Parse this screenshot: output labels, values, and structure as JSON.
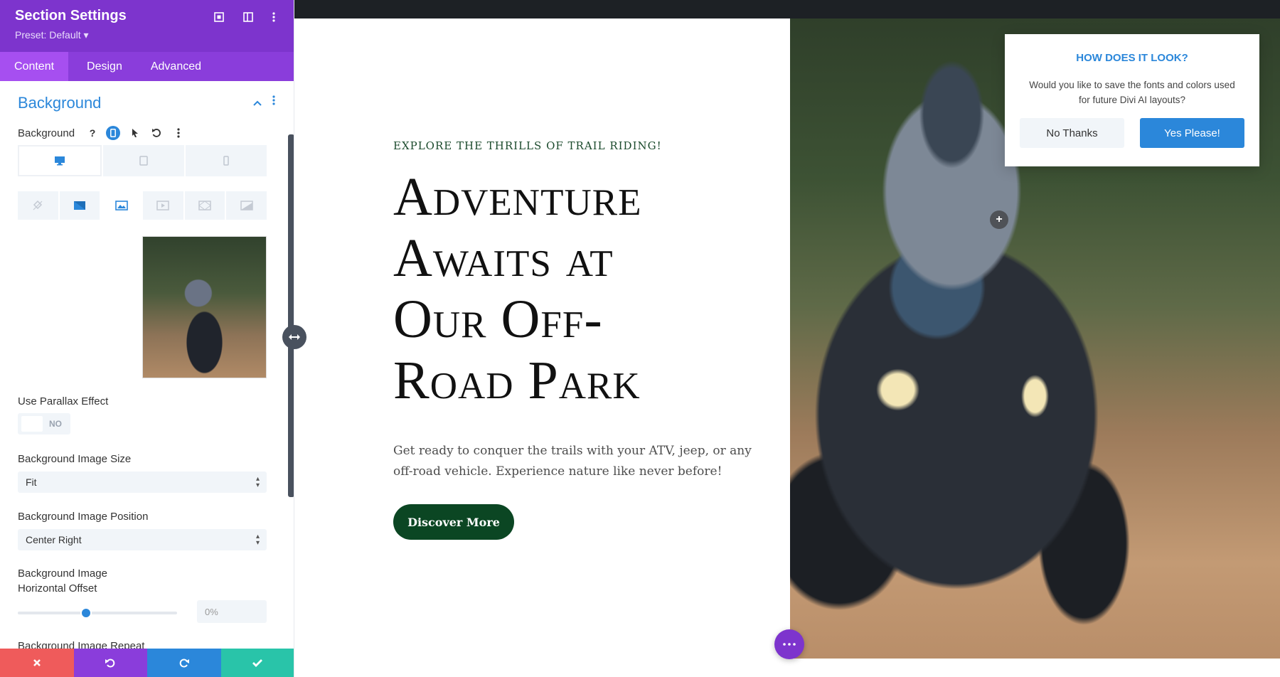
{
  "panel": {
    "title": "Section Settings",
    "preset": "Preset: Default ▾",
    "tabs": [
      {
        "label": "Content",
        "active": true
      },
      {
        "label": "Design",
        "active": false
      },
      {
        "label": "Advanced",
        "active": false
      }
    ],
    "section_title": "Background",
    "background_label": "Background",
    "parallax": {
      "label": "Use Parallax Effect",
      "value": "NO"
    },
    "image_size": {
      "label": "Background Image Size",
      "value": "Fit"
    },
    "image_position": {
      "label": "Background Image Position",
      "value": "Center Right"
    },
    "h_offset": {
      "label_line1": "Background Image",
      "label_line2": "Horizontal Offset",
      "value": "0%",
      "slider_fraction": 0.43
    },
    "repeat_label": "Background Image Repeat"
  },
  "canvas": {
    "eyebrow": "EXPLORE THE THRILLS OF TRAIL RIDING!",
    "headline_lines": [
      "Adventure",
      "Awaits at",
      "Our Off-",
      "Road Park"
    ],
    "paragraph": "Get ready to conquer the trails with your ATV, jeep, or any off-road vehicle. Experience nature like never before!",
    "button": "Discover More"
  },
  "popup": {
    "title": "HOW DOES IT LOOK?",
    "body": "Would you like to save the fonts and colors used for future Divi AI layouts?",
    "no_label": "No Thanks",
    "yes_label": "Yes Please!"
  },
  "colors": {
    "brand_purple": "#7d34cd",
    "accent_blue": "#2b87da",
    "button_green": "#0b4623",
    "footer_red": "#ef5b5b",
    "footer_purple": "#8a3ddb",
    "footer_blue": "#2b87da",
    "footer_teal": "#29c4a9"
  }
}
